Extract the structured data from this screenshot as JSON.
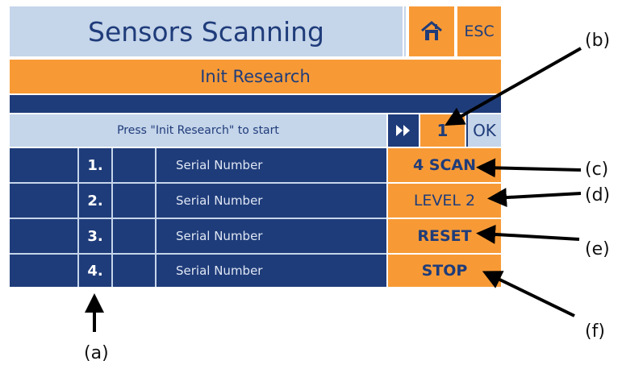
{
  "header": {
    "title": "Sensors Scanning",
    "home_icon": "home-icon",
    "esc_label": "ESC"
  },
  "init_button": {
    "label": "Init Research"
  },
  "status": {
    "message": "Press \"Init Research\" to start",
    "forward_icon": "fast-forward-icon",
    "count": "1",
    "ok_label": "OK"
  },
  "rows": [
    {
      "index": "1.",
      "serial": "Serial Number"
    },
    {
      "index": "2.",
      "serial": "Serial Number"
    },
    {
      "index": "3.",
      "serial": "Serial Number"
    },
    {
      "index": "4.",
      "serial": "Serial Number"
    }
  ],
  "actions": {
    "scan": "4 SCAN",
    "level": "LEVEL 2",
    "reset": "RESET",
    "stop": "STOP"
  },
  "annotations": {
    "a": "(a)",
    "b": "(b)",
    "c": "(c)",
    "d": "(d)",
    "e": "(e)",
    "f": "(f)"
  },
  "colors": {
    "navy": "#1f3c7a",
    "light_blue": "#c5d5ea",
    "orange": "#f79a36"
  }
}
